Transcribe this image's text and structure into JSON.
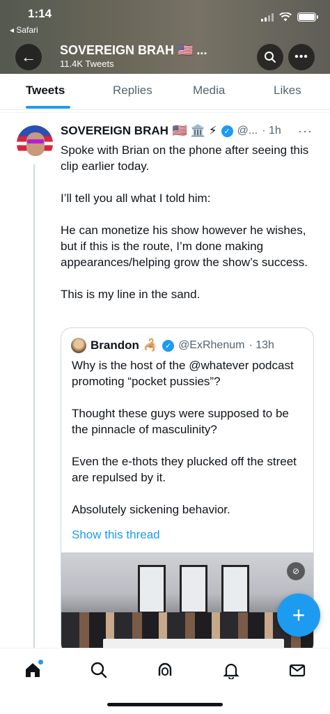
{
  "status_bar": {
    "time": "1:14",
    "back_app": "◂ Safari"
  },
  "header": {
    "name": "SOVEREIGN BRAH 🇺🇸 ...",
    "tweet_count": "11.4K Tweets"
  },
  "tabs": [
    "Tweets",
    "Replies",
    "Media",
    "Likes"
  ],
  "tweet": {
    "author": "SOVEREIGN BRAH",
    "emojis": "🇺🇸 🏛️ ⚡",
    "handle": "@...",
    "time": "· 1h",
    "paragraphs": [
      "Spoke with Brian on the phone after seeing this clip earlier today.",
      "I’ll tell you all what I told him:",
      "He can monetize his show however he wishes, but if this is the route, I’m done making appearances/helping grow the show’s success.",
      "This is my line in the sand."
    ]
  },
  "quote": {
    "author": "Brandon",
    "emoji": "🦂",
    "handle": "@ExRhenum",
    "time": "· 13h",
    "paragraphs": [
      "Why is the host of the @whatever podcast promoting “pocket pussies”?",
      "Thought these guys were supposed to be the pinnacle of masculinity?",
      "Even the e-thots they plucked off the street are repulsed by it.",
      "Absolutely sickening behavior."
    ],
    "show_thread": "Show this thread"
  },
  "colors": {
    "accent": "#1d9bf0",
    "text": "#0f1419",
    "muted": "#536471"
  },
  "icons": [
    "back-arrow-icon",
    "search-icon",
    "more-icon",
    "verified-icon",
    "compose-icon",
    "home-icon",
    "explore-icon",
    "spaces-icon",
    "notifications-icon",
    "messages-icon"
  ]
}
